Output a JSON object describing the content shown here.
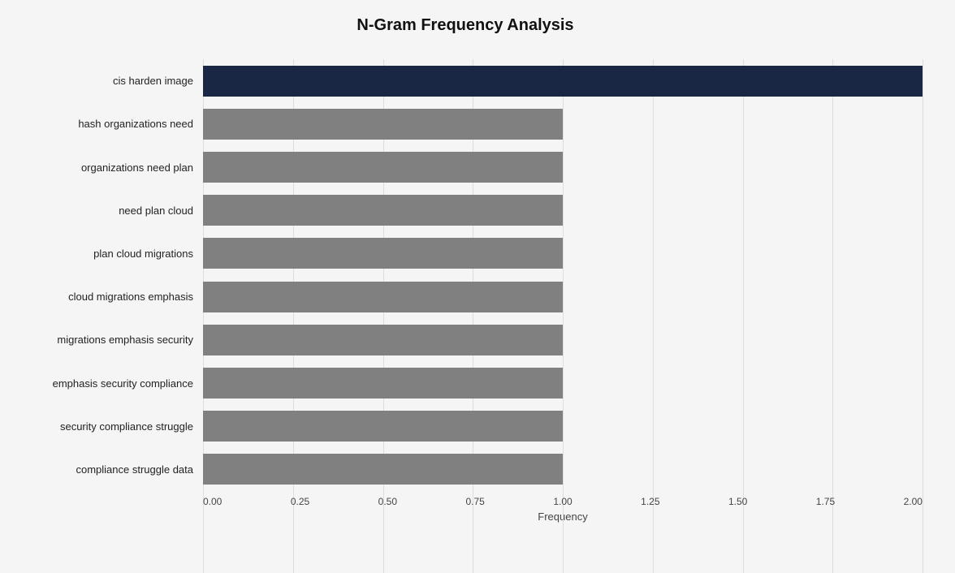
{
  "title": "N-Gram Frequency Analysis",
  "xAxisLabel": "Frequency",
  "xTicks": [
    "0.00",
    "0.25",
    "0.50",
    "0.75",
    "1.00",
    "1.25",
    "1.50",
    "1.75",
    "2.00"
  ],
  "maxValue": 2.0,
  "bars": [
    {
      "label": "cis harden image",
      "value": 2.0,
      "type": "primary"
    },
    {
      "label": "hash organizations need",
      "value": 1.0,
      "type": "secondary"
    },
    {
      "label": "organizations need plan",
      "value": 1.0,
      "type": "secondary"
    },
    {
      "label": "need plan cloud",
      "value": 1.0,
      "type": "secondary"
    },
    {
      "label": "plan cloud migrations",
      "value": 1.0,
      "type": "secondary"
    },
    {
      "label": "cloud migrations emphasis",
      "value": 1.0,
      "type": "secondary"
    },
    {
      "label": "migrations emphasis security",
      "value": 1.0,
      "type": "secondary"
    },
    {
      "label": "emphasis security compliance",
      "value": 1.0,
      "type": "secondary"
    },
    {
      "label": "security compliance struggle",
      "value": 1.0,
      "type": "secondary"
    },
    {
      "label": "compliance struggle data",
      "value": 1.0,
      "type": "secondary"
    }
  ],
  "colors": {
    "primary": "#1a2744",
    "secondary": "#808080",
    "gridLine": "#dddddd",
    "background": "#f5f5f5"
  }
}
